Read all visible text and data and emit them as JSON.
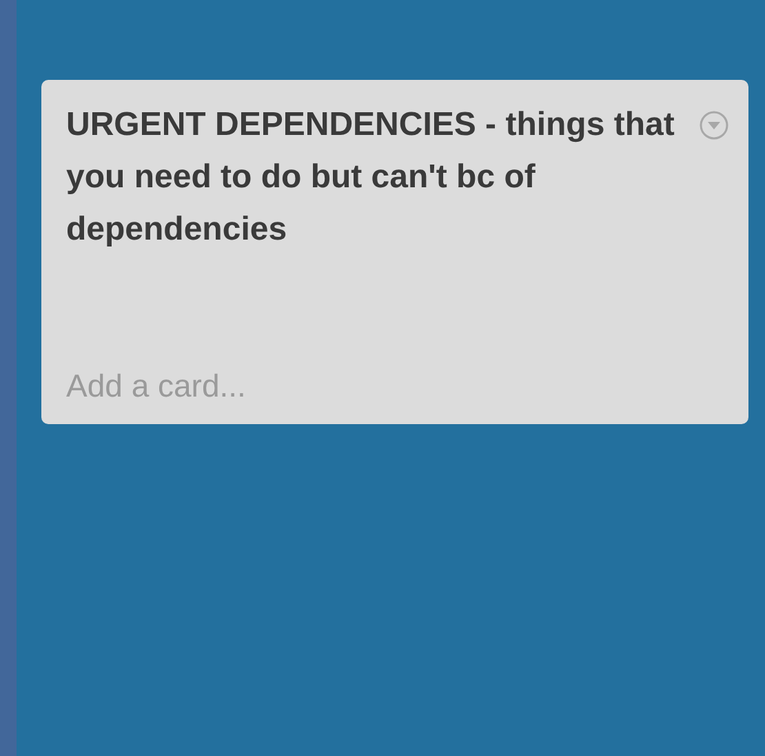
{
  "list": {
    "title": "URGENT DEPENDENCIES - things that you need to do but can't bc of dependencies",
    "add_card": "Add a card..."
  }
}
